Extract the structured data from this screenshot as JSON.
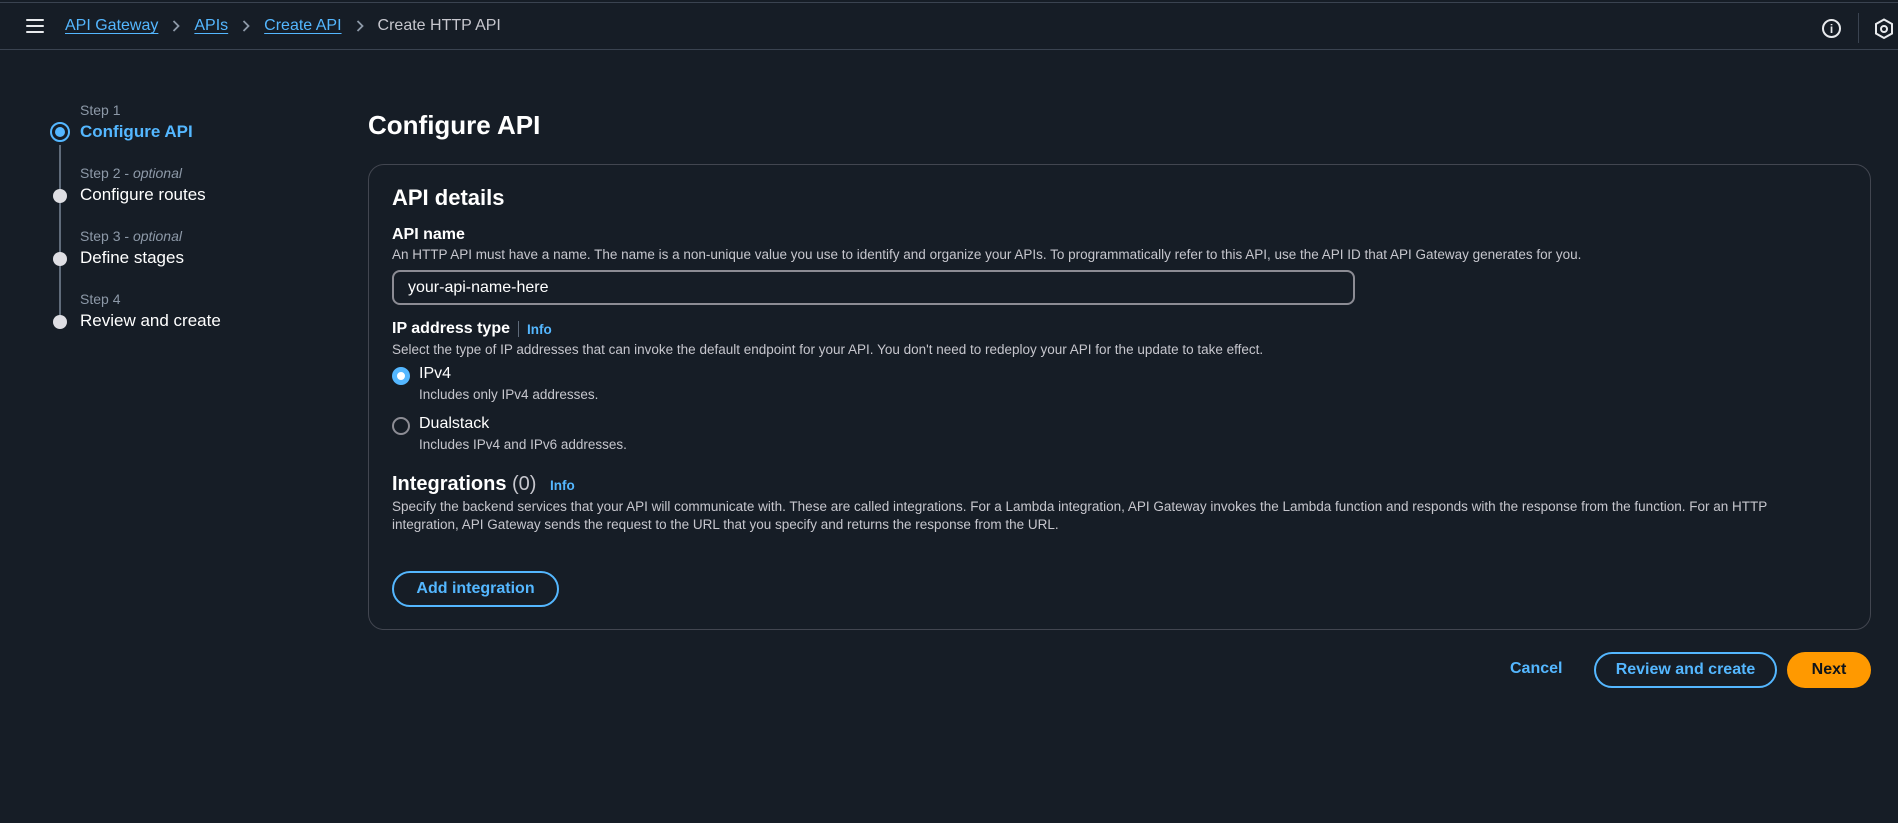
{
  "breadcrumb": {
    "items": [
      "API Gateway",
      "APIs",
      "Create API"
    ],
    "current": "Create HTTP API"
  },
  "steps": [
    {
      "label": "Step 1",
      "optional": "",
      "name": "Configure API"
    },
    {
      "label": "Step 2",
      "optional": "optional",
      "name": "Configure routes"
    },
    {
      "label": "Step 3",
      "optional": "optional",
      "name": "Define stages"
    },
    {
      "label": "Step 4",
      "optional": "",
      "name": "Review and create"
    }
  ],
  "page_title": "Configure API",
  "panel": {
    "title": "API details",
    "api_name": {
      "label": "API name",
      "description": "An HTTP API must have a name. The name is a non-unique value you use to identify and organize your APIs. To programmatically refer to this API, use the API ID that API Gateway generates for you.",
      "value": "your-api-name-here"
    },
    "ip_type": {
      "label": "IP address type",
      "info": "Info",
      "description": "Select the type of IP addresses that can invoke the default endpoint for your API. You don't need to redeploy your API for the update to take effect.",
      "options": [
        {
          "label": "IPv4",
          "description": "Includes only IPv4 addresses.",
          "selected": true
        },
        {
          "label": "Dualstack",
          "description": "Includes IPv4 and IPv6 addresses.",
          "selected": false
        }
      ]
    },
    "integrations": {
      "title": "Integrations",
      "count": "(0)",
      "info": "Info",
      "description": "Specify the backend services that your API will communicate with. These are called integrations. For a Lambda integration, API Gateway invokes the Lambda function and responds with the response from the function. For an HTTP integration, API Gateway sends the request to the URL that you specify and returns the response from the URL.",
      "add_button": "Add integration"
    }
  },
  "footer": {
    "cancel": "Cancel",
    "review": "Review and create",
    "next": "Next"
  },
  "colors": {
    "background": "#161d26",
    "accent": "#54b7ff",
    "primary_button": "#ff9900"
  }
}
